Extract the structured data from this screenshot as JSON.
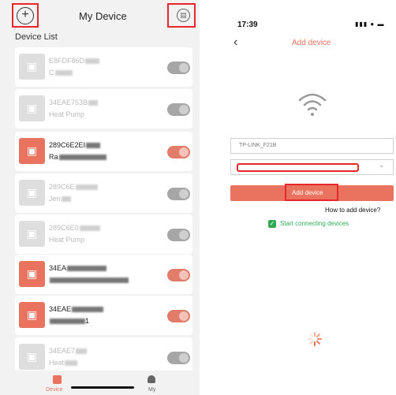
{
  "left": {
    "title": "My Device",
    "list_label": "Device List",
    "add_icon": "plus-circle-icon",
    "message_icon": "message-icon",
    "devices": [
      {
        "line1": "E8FDF86D",
        "line2": "C",
        "on": false
      },
      {
        "line1": "34EAE753B",
        "line2": "Heat Pump",
        "on": false
      },
      {
        "line1": "289C6E2EI",
        "line2": "Ra",
        "on": true
      },
      {
        "line1": "289C6E",
        "line2": "Jen",
        "on": false
      },
      {
        "line1": "289C6E0",
        "line2": "Heat Pump",
        "on": false
      },
      {
        "line1": "34EA",
        "line2": "",
        "on": true
      },
      {
        "line1": "34EAE",
        "line2": "1",
        "on": true
      },
      {
        "line1": "34EAE7",
        "line2": "Heat",
        "on": false
      }
    ],
    "tabs": {
      "device": "Device",
      "my": "My"
    }
  },
  "right": {
    "time": "17:39",
    "title": "Add device",
    "ssid": "TP-LINK_F21B",
    "password": "",
    "add_button": "Add device",
    "how_to": "How to add device?",
    "start": "Start connecting devices"
  },
  "colors": {
    "accent": "#e9735e",
    "highlight": "#e8262b",
    "green": "#2fab56"
  }
}
